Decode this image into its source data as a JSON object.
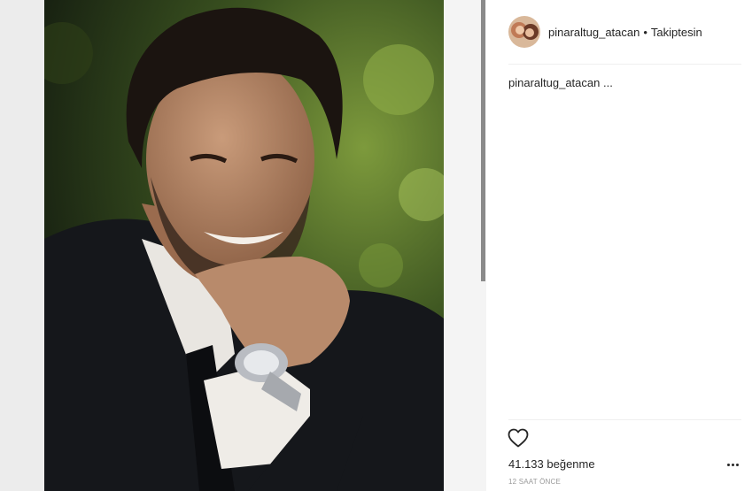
{
  "post": {
    "username": "pinaraltug_atacan",
    "separator": "•",
    "follow_status": "Takiptesin",
    "caption": "pinaraltug_atacan ...",
    "likes": "41.133 beğenme",
    "timestamp": "12 SAAT ÖNCE"
  },
  "icons": {
    "like": "heart-outline-icon",
    "more": "more-options-icon"
  },
  "colors": {
    "text": "#262626",
    "muted": "#999999",
    "divider": "#efefef"
  }
}
